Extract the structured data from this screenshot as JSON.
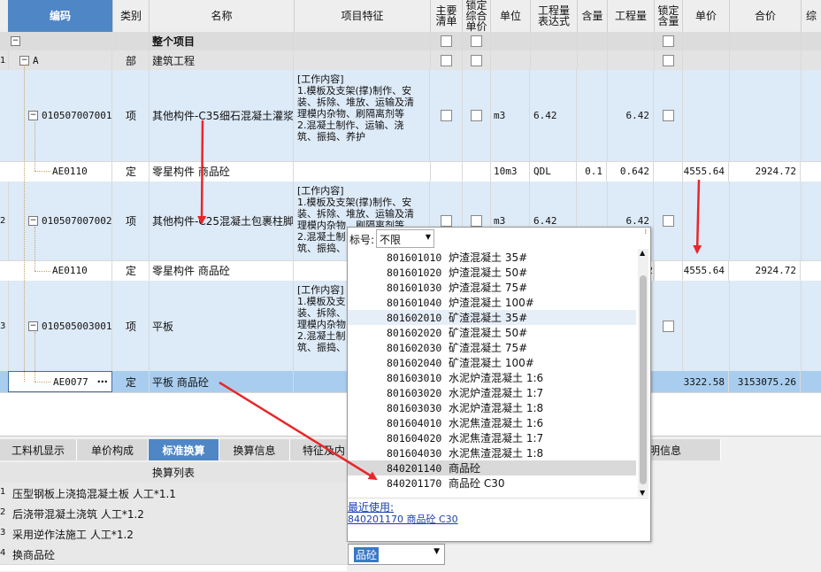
{
  "header": {
    "columns": [
      {
        "label": "编码"
      },
      {
        "label": "类别"
      },
      {
        "label": "名称"
      },
      {
        "label": "项目特征"
      },
      {
        "label": "主要\n清单"
      },
      {
        "label": "锁定\n综合\n单价"
      },
      {
        "label": "单位"
      },
      {
        "label": "工程量\n表达式"
      },
      {
        "label": "含量"
      },
      {
        "label": "工程量"
      },
      {
        "label": "锁定\n含量"
      },
      {
        "label": "单价"
      },
      {
        "label": "合价"
      },
      {
        "label": "综"
      }
    ]
  },
  "rows": [
    {
      "code": "",
      "type": "",
      "name": "整个项目",
      "feature": "",
      "unit": "",
      "expr": "",
      "content": "",
      "qty": "",
      "price": "",
      "total": ""
    },
    {
      "num": "1",
      "code": "A",
      "type": "部",
      "name": "建筑工程",
      "feature": "",
      "unit": "",
      "expr": "",
      "content": "",
      "qty": "",
      "price": "",
      "total": ""
    },
    {
      "num": "",
      "code": "010507007001",
      "type": "项",
      "name": "其他构件-C35细石混凝土灌浆",
      "feature": "[工作内容]\n1.模板及支架(撑)制作、安\n装、拆除、堆放、运输及清\n理模内杂物、刷隔离剂等\n2.混凝土制作、运输、浇\n筑、振捣、养护",
      "unit": "m3",
      "expr": "6.42",
      "content": "",
      "qty": "6.42",
      "price": "",
      "total": ""
    },
    {
      "num": "",
      "code": "AE0110",
      "type": "定",
      "name": "零星构件 商品砼",
      "feature": "",
      "unit": "10m3",
      "expr": "QDL",
      "content": "0.1",
      "qty": "0.642",
      "price": "4555.64",
      "total": "2924.72"
    },
    {
      "num": "2",
      "code": "010507007002",
      "type": "项",
      "name": "其他构件-C25混凝土包裹柱脚",
      "feature": "[工作内容]\n1.模板及支架(撑)制作、安\n装、拆除、堆放、运输及清\n理模内杂物、刷隔离剂等\n2.混凝土制\n筑、振捣、",
      "unit": "m3",
      "expr": "6.42",
      "content": "",
      "qty": "6.42",
      "price": "",
      "total": ""
    },
    {
      "num": "",
      "code": "AE0110",
      "type": "定",
      "name": "零星构件 商品砼",
      "feature": "",
      "unit": "",
      "expr": "",
      "content": "",
      "qty": "2",
      "price": "4555.64",
      "total": "2924.72"
    },
    {
      "num": "3",
      "code": "010505003001",
      "type": "项",
      "name": "平板",
      "feature": "[工作内容]\n1.模板及支\n装、拆除、\n理模内杂物\n2.混凝土制\n筑、振捣、",
      "unit": "",
      "expr": "",
      "content": "",
      "qty": "",
      "price": "",
      "total": ""
    },
    {
      "num": "",
      "code": "AE0077",
      "type": "定",
      "name": "平板 商品砼",
      "feature": "",
      "unit": "",
      "expr": "",
      "content": "",
      "qty": "",
      "price": "3322.58",
      "total": "3153075.26"
    }
  ],
  "bottom_tabs": [
    {
      "label": "工料机显示"
    },
    {
      "label": "单价构成"
    },
    {
      "label": "标准换算"
    },
    {
      "label": "换算信息"
    },
    {
      "label": "特征及内"
    },
    {
      "label": "明信息"
    }
  ],
  "conv": {
    "header": "换算列表",
    "items": [
      {
        "num": "1",
        "label": "压型钢板上浇捣混凝土板 人工*1.1"
      },
      {
        "num": "2",
        "label": "后浇带混凝土浇筑 人工*1.2"
      },
      {
        "num": "3",
        "label": "采用逆作法施工 人工*1.2"
      },
      {
        "num": "4",
        "label": "换商品砼"
      }
    ],
    "select_value": "品砼"
  },
  "popup": {
    "label": "标号:",
    "filter": "不限",
    "items": [
      {
        "code": "801601010",
        "name": "炉渣混凝土 35#"
      },
      {
        "code": "801601020",
        "name": "炉渣混凝土 50#"
      },
      {
        "code": "801601030",
        "name": "炉渣混凝土 75#"
      },
      {
        "code": "801601040",
        "name": "炉渣混凝土 100#"
      },
      {
        "code": "801602010",
        "name": "矿渣混凝土 35#"
      },
      {
        "code": "801602020",
        "name": "矿渣混凝土 50#"
      },
      {
        "code": "801602030",
        "name": "矿渣混凝土 75#"
      },
      {
        "code": "801602040",
        "name": "矿渣混凝土 100#"
      },
      {
        "code": "801603010",
        "name": "水泥炉渣混凝土 1:6"
      },
      {
        "code": "801603020",
        "name": "水泥炉渣混凝土 1:7"
      },
      {
        "code": "801603030",
        "name": "水泥炉渣混凝土 1:8"
      },
      {
        "code": "801604010",
        "name": "水泥焦渣混凝土 1:6"
      },
      {
        "code": "801604020",
        "name": "水泥焦渣混凝土 1:7"
      },
      {
        "code": "801604030",
        "name": "水泥焦渣混凝土 1:8"
      },
      {
        "code": "840201140",
        "name": "商品砼"
      },
      {
        "code": "840201170",
        "name": "商品砼 C30"
      }
    ],
    "recent_label": "最近使用:",
    "recent_item": "840201170 商品砼 C30"
  },
  "colors": {
    "accent": "#4f86c6",
    "arrow": "#e8262a",
    "selected_row": "#a9cdee",
    "item_row": "#ddeaf7"
  }
}
